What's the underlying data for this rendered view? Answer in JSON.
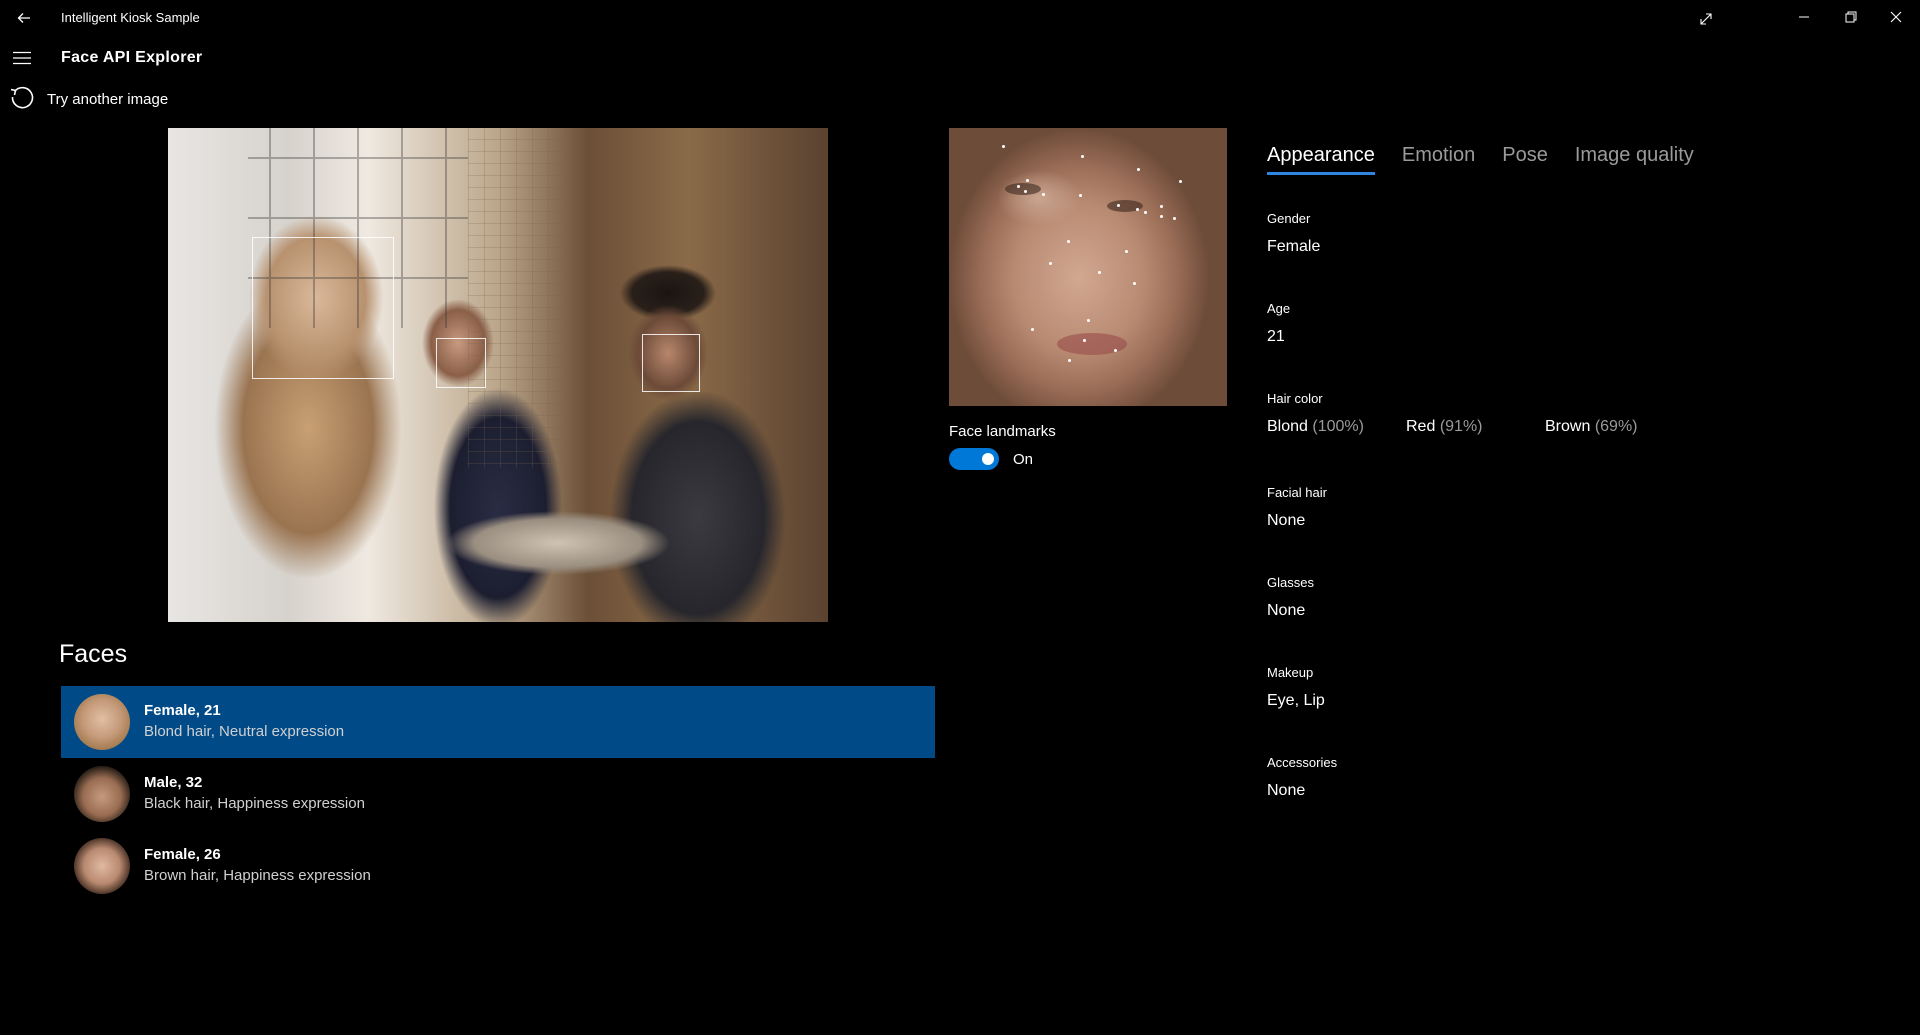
{
  "window": {
    "title": "Intelligent Kiosk Sample"
  },
  "header": {
    "page_title": "Face API Explorer",
    "retry_label": "Try another image"
  },
  "faces_section": {
    "heading": "Faces",
    "items": [
      {
        "title": "Female, 21",
        "subtitle": "Blond hair, Neutral expression",
        "selected": true
      },
      {
        "title": "Male, 32",
        "subtitle": "Black hair, Happiness expression",
        "selected": false
      },
      {
        "title": "Female, 26",
        "subtitle": "Brown hair, Happiness expression",
        "selected": false
      }
    ]
  },
  "landmarks": {
    "label": "Face landmarks",
    "toggle_state": "On"
  },
  "tabs": [
    {
      "label": "Appearance",
      "active": true
    },
    {
      "label": "Emotion",
      "active": false
    },
    {
      "label": "Pose",
      "active": false
    },
    {
      "label": "Image quality",
      "active": false
    }
  ],
  "appearance": {
    "gender": {
      "label": "Gender",
      "value": "Female"
    },
    "age": {
      "label": "Age",
      "value": "21"
    },
    "hair_color": {
      "label": "Hair color",
      "values": [
        {
          "name": "Blond",
          "confidence": "(100%)"
        },
        {
          "name": "Red",
          "confidence": "(91%)"
        },
        {
          "name": "Brown",
          "confidence": "(69%)"
        }
      ]
    },
    "facial_hair": {
      "label": "Facial hair",
      "value": "None"
    },
    "glasses": {
      "label": "Glasses",
      "value": "None"
    },
    "makeup": {
      "label": "Makeup",
      "value": "Eye, Lip"
    },
    "accessories": {
      "label": "Accessories",
      "value": "None"
    }
  },
  "colors": {
    "background": "#000000",
    "selection": "#004a87",
    "accent": "#0078d7",
    "tab_underline": "#2f86e0",
    "muted_text": "#9a9a9a"
  },
  "icons": {
    "back": "back-arrow-icon",
    "menu": "hamburger-menu-icon",
    "retry": "refresh-icon",
    "expand": "expand-icon",
    "minimize": "minimize-icon",
    "maximize": "restore-icon",
    "close": "close-icon"
  }
}
